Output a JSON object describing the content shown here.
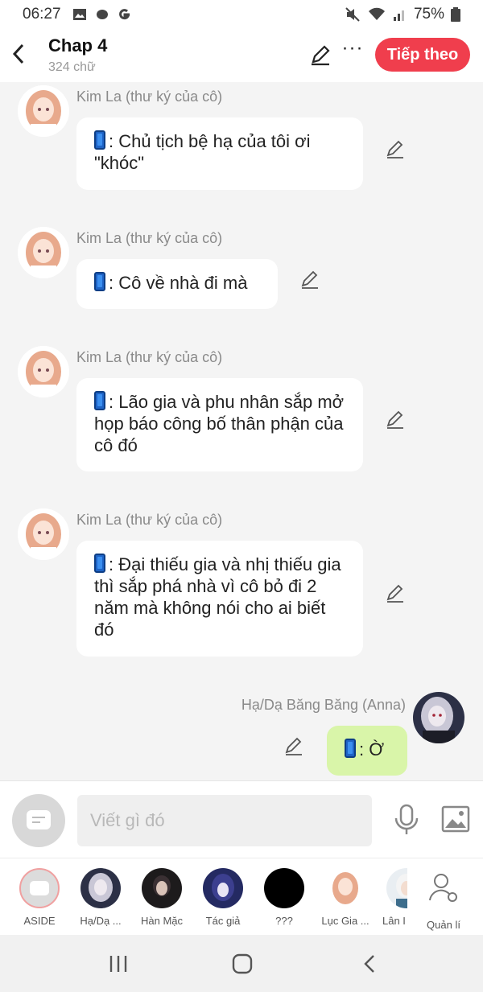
{
  "status": {
    "time": "06:27",
    "battery": "75%"
  },
  "header": {
    "title": "Chap 4",
    "subtitle": "324 chữ",
    "next_label": "Tiếp theo",
    "more_label": "···"
  },
  "messages": [
    {
      "sender": "Kim La (thư ký của cô)",
      "text": ": Chủ tịch bệ hạ của tôi ơi \"khóc\""
    },
    {
      "sender": "Kim La (thư ký của cô)",
      "text": ": Cô về nhà đi mà"
    },
    {
      "sender": "Kim La (thư ký của cô)",
      "text": ": Lão gia và phu nhân sắp mở họp báo công bố thân phận của cô đó"
    },
    {
      "sender": "Kim La (thư ký của cô)",
      "text": ": Đại thiếu gia và nhị thiếu gia thì sắp phá nhà vì cô bỏ đi 2 năm mà không nói cho ai biết đó"
    },
    {
      "sender": "Hạ/Dạ Băng Băng (Anna)",
      "text": ": Ờ"
    }
  ],
  "input": {
    "placeholder": "Viết gì đó"
  },
  "characters": [
    {
      "label": "ASIDE"
    },
    {
      "label": "Hạ/Dạ ..."
    },
    {
      "label": "Hàn Mặc"
    },
    {
      "label": "Tác giả"
    },
    {
      "label": "???"
    },
    {
      "label": "Lục Gia ..."
    },
    {
      "label": "Lân I"
    },
    {
      "label": "Quản lí"
    }
  ],
  "colors": {
    "accent": "#f03e4d",
    "own_bubble": "#d9f5a9",
    "bg": "#f4f4f4"
  }
}
